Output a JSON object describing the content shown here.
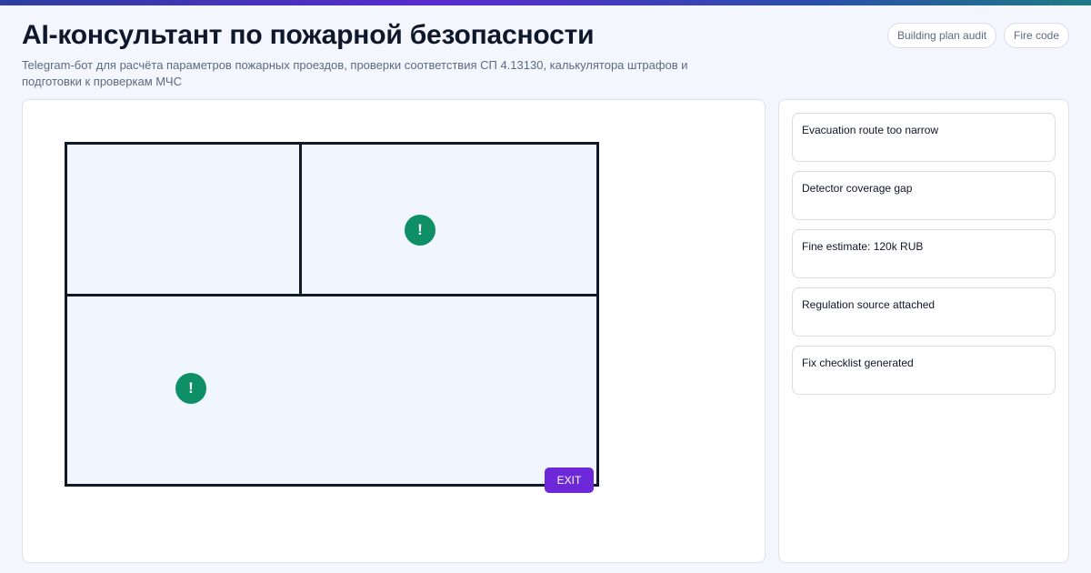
{
  "header": {
    "title": "AI-консультант по пожарной безопасности",
    "subtitle": "Telegram-бот для расчёта параметров пожарных проездов, проверки соответствия СП 4.13130, калькулятора штрафов и подготовки к проверкам МЧС",
    "tags": [
      "Building plan audit",
      "Fire code"
    ]
  },
  "plan": {
    "markers": [
      "!",
      "!"
    ],
    "exit_label": "EXIT"
  },
  "findings": [
    "Evacuation route too narrow",
    "Detector coverage gap",
    "Fine estimate: 120k RUB",
    "Regulation source attached",
    "Fix checklist generated"
  ],
  "colors": {
    "marker": "#0e8f66",
    "exit": "#6d28d9",
    "walls": "#111827"
  },
  "icons": {
    "marker": "warning-marker-icon"
  }
}
